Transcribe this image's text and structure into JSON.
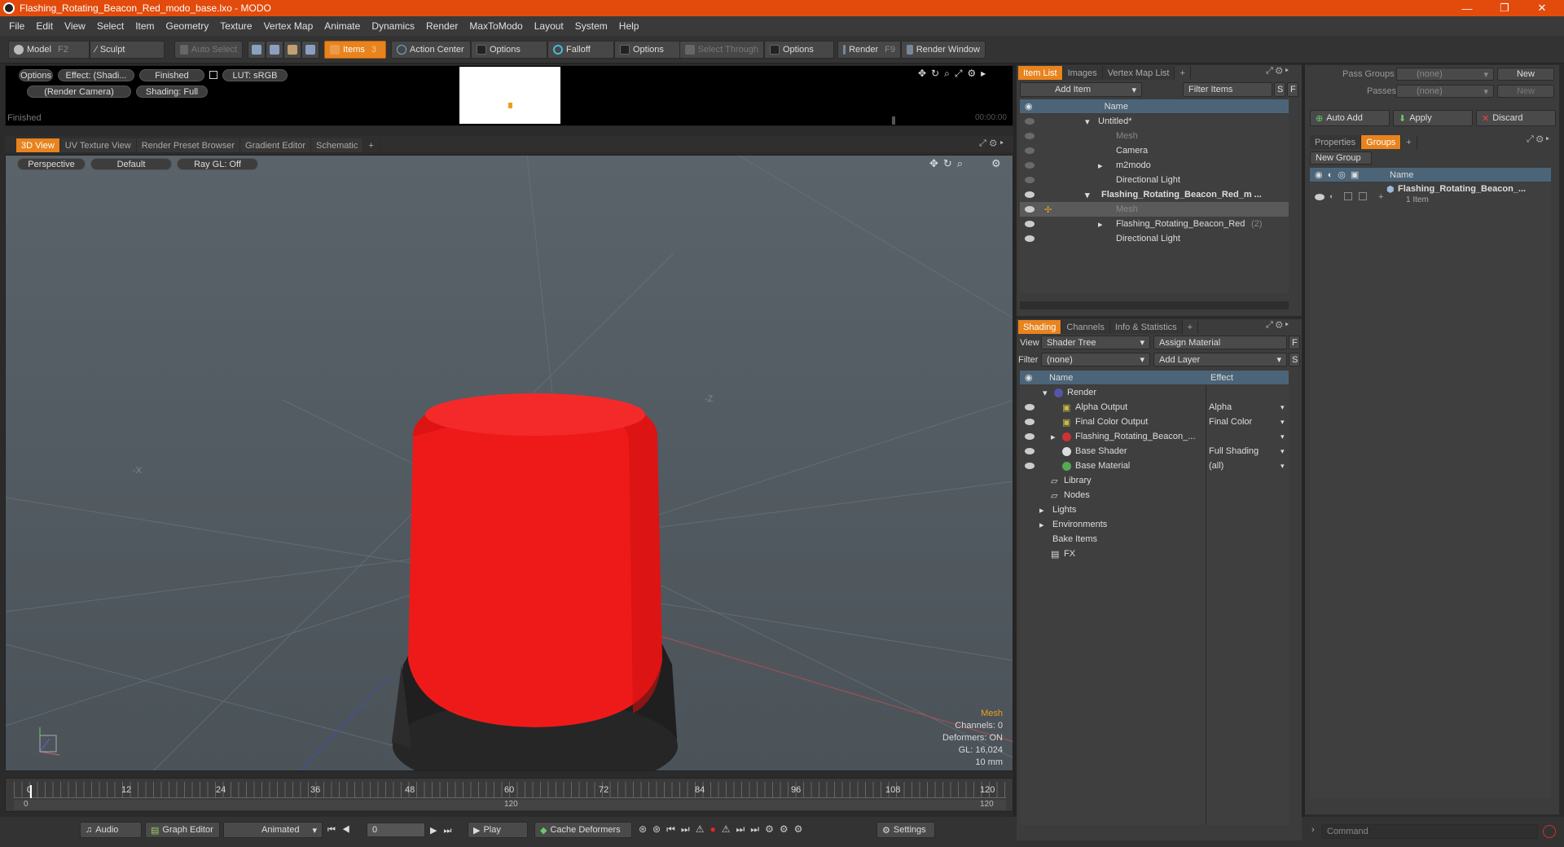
{
  "window": {
    "title": "Flashing_Rotating_Beacon_Red_modo_base.lxo - MODO",
    "minimize": "—",
    "maximize": "❐",
    "close": "✕"
  },
  "menu": [
    "File",
    "Edit",
    "View",
    "Select",
    "Item",
    "Geometry",
    "Texture",
    "Vertex Map",
    "Animate",
    "Dynamics",
    "Render",
    "MaxToModo",
    "Layout",
    "System",
    "Help"
  ],
  "toolbar": {
    "model": "Model",
    "model_key": "F2",
    "sculpt": "Sculpt",
    "auto_select": "Auto Select",
    "items": "Items",
    "items_key": "3",
    "action_center": "Action Center",
    "options1": "Options",
    "falloff": "Falloff",
    "options2": "Options",
    "select_through": "Select Through",
    "options3": "Options",
    "render": "Render",
    "render_key": "F9",
    "render_window": "Render Window"
  },
  "render_preview": {
    "options": "Options",
    "effect": "Effect: (Shadi...",
    "finished_pill": "Finished",
    "lut": "LUT: sRGB",
    "camera": "(Render Camera)",
    "shading": "Shading: Full",
    "status": "Finished",
    "time": "00:00:00"
  },
  "viewport_tabs": [
    "3D View",
    "UV Texture View",
    "Render Preset Browser",
    "Gradient Editor",
    "Schematic",
    "+"
  ],
  "viewport": {
    "perspective": "Perspective",
    "default": "Default",
    "raygl": "Ray GL: Off",
    "axis_z": "-Z",
    "axis_x": "-X",
    "info": {
      "mesh": "Mesh",
      "channels": "Channels: 0",
      "deformers": "Deformers: ON",
      "gl": "GL: 16,024",
      "scale": "10 mm"
    }
  },
  "timeline": {
    "ticks": [
      "0",
      "12",
      "24",
      "36",
      "48",
      "60",
      "72",
      "84",
      "96",
      "108",
      "120"
    ],
    "range_start": "0",
    "range_mid": "120",
    "range_end": "120"
  },
  "bottom": {
    "audio": "Audio",
    "graph_editor": "Graph Editor",
    "animated": "Animated",
    "frame": "0",
    "play": "Play",
    "cache": "Cache Deformers",
    "settings": "Settings",
    "command_placeholder": "Command"
  },
  "item_list": {
    "tabs": [
      "Item List",
      "Images",
      "Vertex Map List",
      "+"
    ],
    "add_item": "Add Item",
    "filter_items": "Filter Items",
    "s": "S",
    "f": "F",
    "col_name": "Name",
    "rows": [
      {
        "label": "Untitled*",
        "indent": 0,
        "dim": false,
        "bold": false
      },
      {
        "label": "Mesh",
        "indent": 1,
        "dim": true,
        "bold": false
      },
      {
        "label": "Camera",
        "indent": 1,
        "dim": false,
        "bold": false
      },
      {
        "label": "m2modo",
        "indent": 1,
        "dim": false,
        "bold": false
      },
      {
        "label": "Directional Light",
        "indent": 1,
        "dim": false,
        "bold": false
      },
      {
        "label": "Flashing_Rotating_Beacon_Red_m ...",
        "indent": 0,
        "dim": false,
        "bold": true
      },
      {
        "label": "Mesh",
        "indent": 1,
        "dim": true,
        "bold": false
      },
      {
        "label": "Flashing_Rotating_Beacon_Red",
        "indent": 1,
        "dim": false,
        "bold": false,
        "suffix": "(2)"
      },
      {
        "label": "Directional Light",
        "indent": 1,
        "dim": false,
        "bold": false
      }
    ]
  },
  "shading": {
    "tabs": [
      "Shading",
      "Channels",
      "Info & Statistics",
      "+"
    ],
    "view_label": "View",
    "view_value": "Shader Tree",
    "assign_material": "Assign Material",
    "filter_label": "Filter",
    "filter_value": "(none)",
    "add_layer": "Add Layer",
    "f": "F",
    "s": "S",
    "col_name": "Name",
    "col_effect": "Effect",
    "rows": [
      {
        "label": "Render",
        "effect": ""
      },
      {
        "label": "Alpha Output",
        "effect": "Alpha"
      },
      {
        "label": "Final Color Output",
        "effect": "Final Color"
      },
      {
        "label": "Flashing_Rotating_Beacon_...",
        "effect": ""
      },
      {
        "label": "Base Shader",
        "effect": "Full Shading"
      },
      {
        "label": "Base Material",
        "effect": "(all)"
      },
      {
        "label": "Library",
        "effect": ""
      },
      {
        "label": "Nodes",
        "effect": ""
      },
      {
        "label": "Lights",
        "effect": ""
      },
      {
        "label": "Environments",
        "effect": ""
      },
      {
        "label": "Bake Items",
        "effect": ""
      },
      {
        "label": "FX",
        "effect": ""
      }
    ]
  },
  "right_panel": {
    "pass_groups": "Pass Groups",
    "passes": "Passes",
    "none1": "(none)",
    "none2": "(none)",
    "new1": "New",
    "new2": "New",
    "auto_add": "Auto Add",
    "apply": "Apply",
    "discard": "Discard",
    "tabs": [
      "Properties",
      "Groups",
      "+"
    ],
    "new_group": "New Group",
    "col_name": "Name",
    "group_name": "Flashing_Rotating_Beacon_...",
    "group_count": "1 Item"
  }
}
